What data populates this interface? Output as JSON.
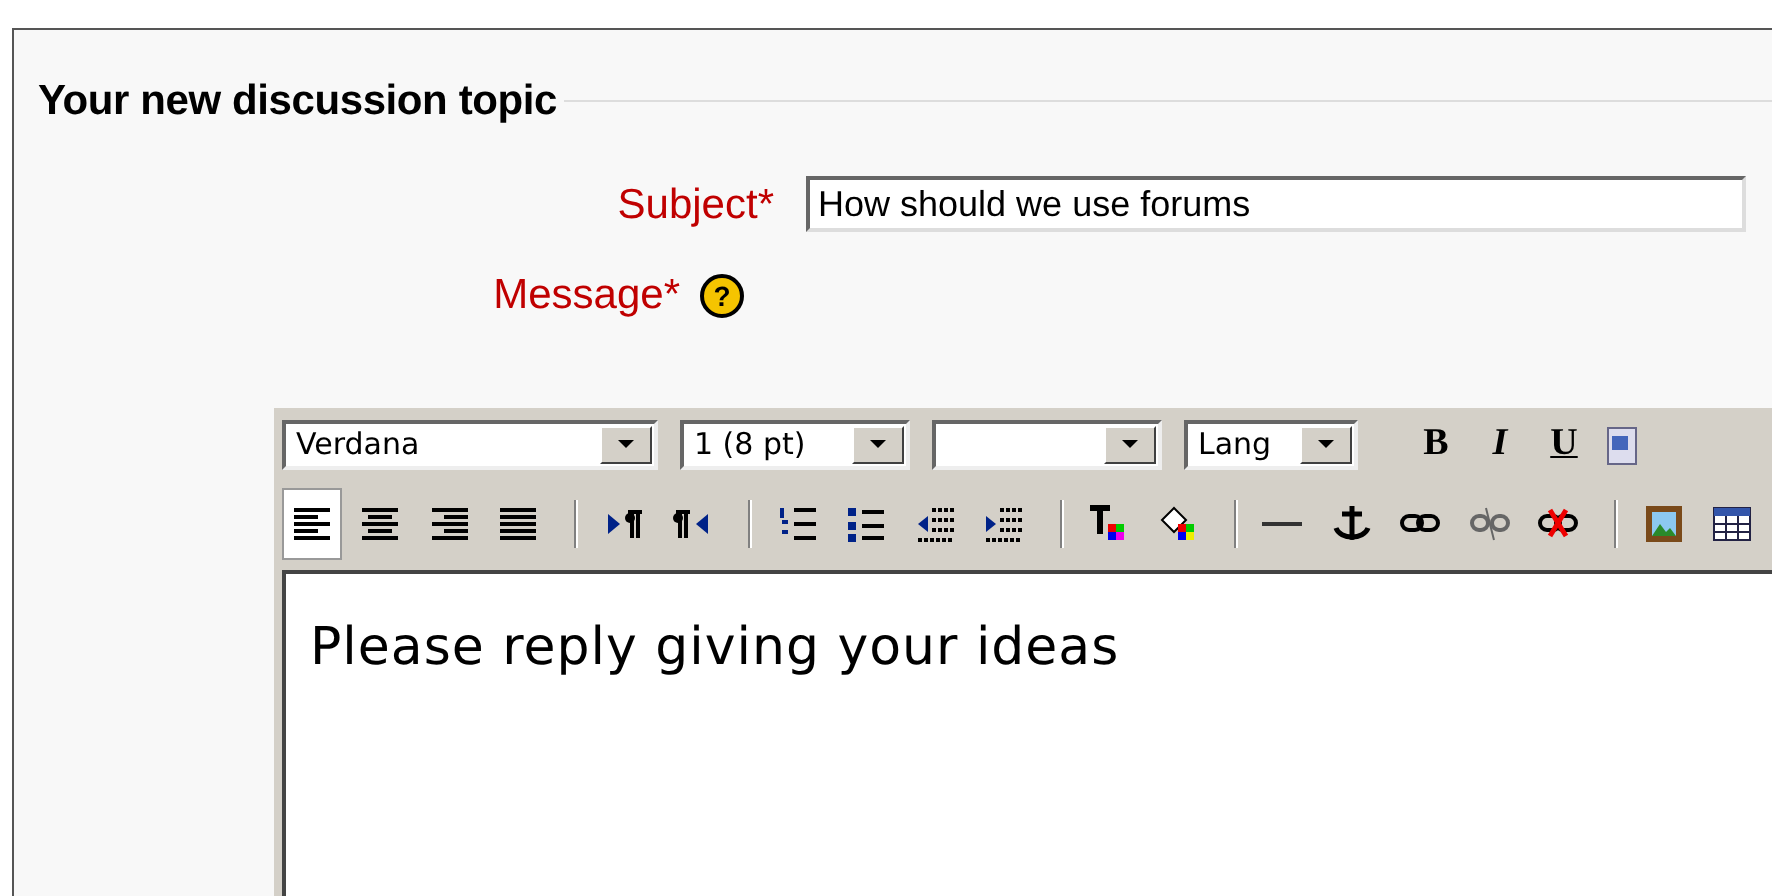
{
  "section": {
    "legend": "Your new discussion topic"
  },
  "subject": {
    "label": "Subject",
    "mark": "*",
    "value": "How should we use forums"
  },
  "message": {
    "label": "Message",
    "mark": "*",
    "help": "?"
  },
  "editor": {
    "selects": [
      {
        "value": "Verdana",
        "kind": "wide"
      },
      {
        "value": "1 (8 pt)",
        "kind": "medium"
      },
      {
        "kind": "medium"
      },
      {
        "value": "Lang",
        "kind": "small"
      }
    ],
    "format_buttons": [
      {
        "label": "B",
        "kind": "bold"
      },
      {
        "label": "I",
        "kind": "italic"
      },
      {
        "label": "U",
        "kind": "underline"
      },
      {
        "kind": "word"
      }
    ],
    "tools": [
      {
        "kind": "align-left",
        "selected": true
      },
      {
        "kind": "align-center",
        "selected": false
      },
      {
        "kind": "align-right",
        "selected": false
      },
      {
        "kind": "justify",
        "selected": false
      },
      {
        "kind": "separator"
      },
      {
        "kind": "ltr",
        "selected": false
      },
      {
        "kind": "rtl",
        "selected": false
      },
      {
        "kind": "separator"
      },
      {
        "kind": "ordered-list",
        "selected": false
      },
      {
        "kind": "unordered-list",
        "selected": false
      },
      {
        "kind": "outdent",
        "selected": false
      },
      {
        "kind": "indent",
        "selected": false
      },
      {
        "kind": "separator"
      },
      {
        "kind": "text-color",
        "selected": false
      },
      {
        "kind": "background-color",
        "selected": false
      },
      {
        "kind": "separator"
      },
      {
        "kind": "horizontal-rule",
        "selected": false
      },
      {
        "kind": "anchor",
        "selected": false
      },
      {
        "kind": "link",
        "selected": false
      },
      {
        "kind": "unlink",
        "selected": false
      },
      {
        "kind": "nolink",
        "selected": false
      },
      {
        "kind": "separator"
      },
      {
        "kind": "image",
        "selected": false
      },
      {
        "kind": "table",
        "selected": false
      }
    ],
    "content": "Please reply giving your ideas"
  }
}
